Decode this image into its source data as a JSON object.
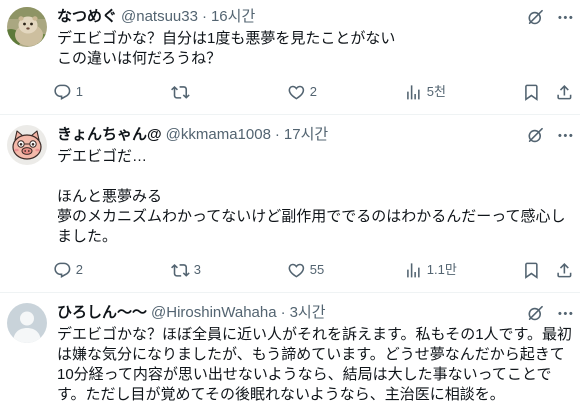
{
  "colors": {
    "background": "#ffffff",
    "text": "#0f1419",
    "secondary": "#536471",
    "divider": "#eff3f4"
  },
  "icons": {
    "grok": "grok-icon",
    "more": "more-icon",
    "reply": "reply-icon",
    "retweet": "retweet-icon",
    "like": "like-icon",
    "views": "views-icon",
    "bookmark": "bookmark-icon",
    "share": "share-icon"
  },
  "tweets": [
    {
      "display_name": "なつめぐ",
      "handle": "@natsuu33",
      "separator": "·",
      "time": "16시간",
      "paragraphs": [
        [
          "デエビゴかな？自分は1度も悪夢を見たことがない",
          "この違いは何だろうね？"
        ]
      ],
      "actions": {
        "reply": "1",
        "like": "2",
        "views": "5천"
      }
    },
    {
      "display_name": "きょんちゃん@",
      "handle": "@kkmama1008",
      "separator": "·",
      "time": "17시간",
      "paragraphs": [
        [
          "デエビゴだ…"
        ],
        [
          "ほんと悪夢みる",
          "夢のメカニズムわかってないけど副作用ででるのはわかるんだーって感心し",
          "ました。"
        ]
      ],
      "actions": {
        "reply": "2",
        "retweet": "3",
        "like": "55",
        "views": "1.1만"
      }
    },
    {
      "display_name": "ひろしん〜〜",
      "handle": "@HiroshinWahaha",
      "separator": "·",
      "time": "3시간",
      "paragraphs": [
        [
          "デエビゴかな？ほぼ全員に近い人がそれを訴えます。私もその1人です。最初",
          "は嫌な気分になりましたが、もう諦めています。どうせ夢なんだから起きて",
          "10分経って内容が思い出せないようなら、結局は大した事ないってことで",
          "す。ただし目が覚めてその後眠れないようなら、主治医に相談を。"
        ]
      ]
    }
  ]
}
